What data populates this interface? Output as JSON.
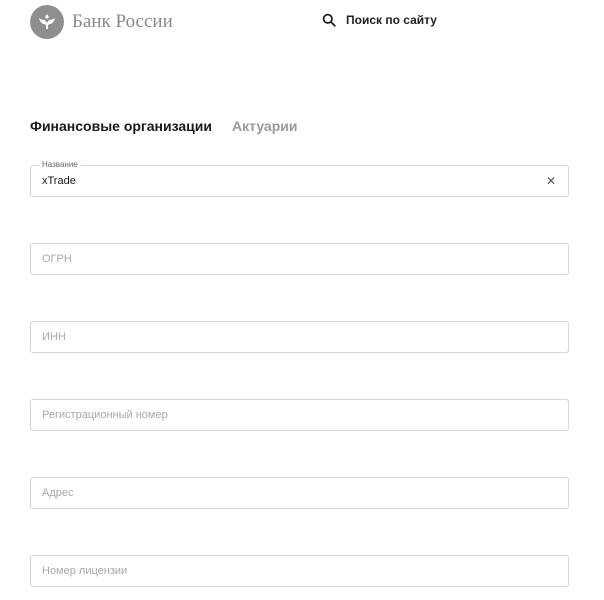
{
  "header": {
    "brand": "Банк России",
    "search_label": "Поиск по сайту"
  },
  "tabs": [
    {
      "label": "Финансовые организации",
      "active": true
    },
    {
      "label": "Актуарии",
      "active": false
    }
  ],
  "form": {
    "name": {
      "label": "Название",
      "value": "xTrade"
    },
    "ogrn": {
      "placeholder": "ОГРН",
      "value": ""
    },
    "inn": {
      "placeholder": "ИНН",
      "value": ""
    },
    "reg_number": {
      "placeholder": "Регистрационный номер",
      "value": ""
    },
    "address": {
      "placeholder": "Адрес",
      "value": ""
    },
    "license_number": {
      "placeholder": "Номер лицензии",
      "value": ""
    }
  },
  "icons": {
    "logo": "eagle-emblem-icon",
    "search": "search-icon",
    "clear": "close-icon"
  },
  "colors": {
    "logo_bg": "#8f8f8f",
    "brand_text": "#8a8a8a",
    "inactive_tab": "#9a9a9a",
    "border": "#d6d6d6"
  }
}
